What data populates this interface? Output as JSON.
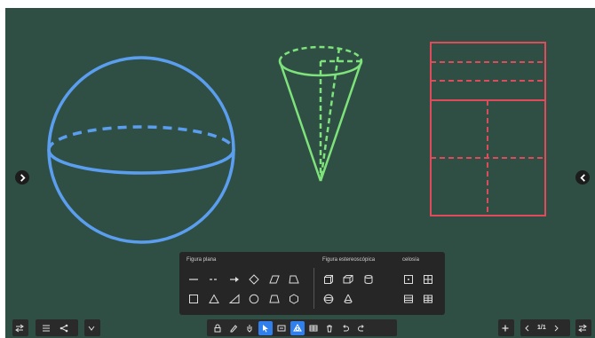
{
  "panel": {
    "plane_title": "Figura plana",
    "stereo_title": "Figura estereoscópica",
    "lattice_title": "celosía"
  },
  "pager": {
    "text": "1/1"
  },
  "colors": {
    "board": "#2f4f45",
    "sphere": "#5b9ef0",
    "cone": "#7ee37a",
    "grid": "#e04a5a",
    "toolbar": "#262626",
    "active_tool": "#2f80ed"
  }
}
